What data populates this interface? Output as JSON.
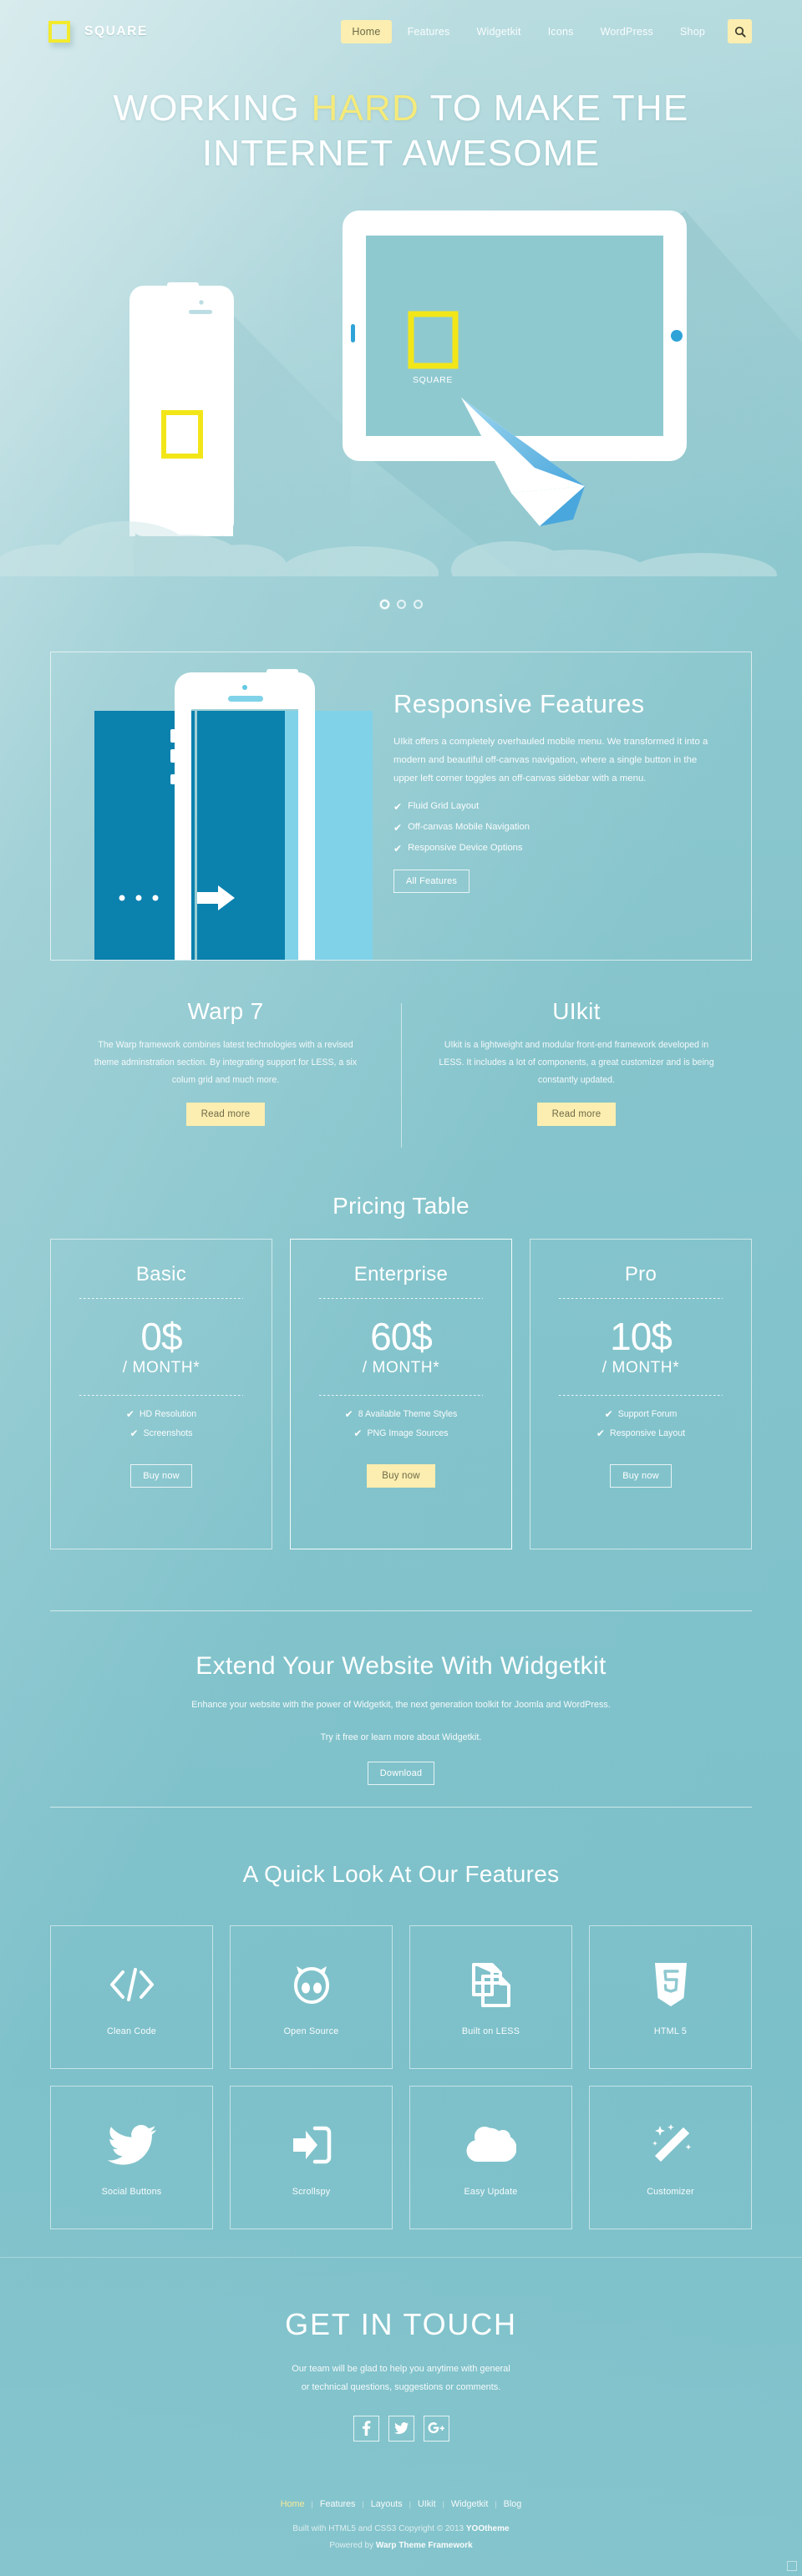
{
  "brand": {
    "name": "SQUARE",
    "mark_color": "#f2ea2e"
  },
  "nav": {
    "items": [
      {
        "label": "Home",
        "active": true
      },
      {
        "label": "Features",
        "active": false
      },
      {
        "label": "Widgetkit",
        "active": false
      },
      {
        "label": "Icons",
        "active": false
      },
      {
        "label": "WordPress",
        "active": false
      },
      {
        "label": "Shop",
        "active": false
      }
    ],
    "search_icon": "search-icon"
  },
  "hero": {
    "line1_a": "WORKING ",
    "line1_accent": "HARD",
    "line1_b": " TO MAKE THE",
    "line2": "INTERNET AWESOME",
    "accent_color": "#f4ea7a",
    "device_label": "SQUARE",
    "slider_dots": 3,
    "slider_active": 1
  },
  "responsive": {
    "title": "Responsive Features",
    "paragraph": "UIkit offers a completely overhauled mobile menu. We transformed it into a modern and beautiful off-canvas navigation, where a single button in the upper left corner toggles an off-canvas sidebar with a menu.",
    "features": [
      "Fluid Grid Layout",
      "Off-canvas Mobile Navigation",
      "Responsive Device Options"
    ],
    "button": "All Features"
  },
  "twocol": [
    {
      "title": "Warp 7",
      "text": "The Warp framework combines latest technologies with a revised theme adminstration section. By integrating support for LESS, a six colum grid and much more.",
      "button": "Read more"
    },
    {
      "title": "UIkit",
      "text": "UIkit is a lightweight and modular front-end framework developed in LESS. It includes a lot of components, a great customizer and is being constantly updated.",
      "button": "Read more"
    }
  ],
  "pricing": {
    "title": "Pricing Table",
    "plans": [
      {
        "name": "Basic",
        "price": "0$",
        "per": "/ MONTH*",
        "features": [
          "HD Resolution",
          "Screenshots"
        ],
        "button": "Buy now",
        "featured": false
      },
      {
        "name": "Enterprise",
        "price": "60$",
        "per": "/ MONTH*",
        "features": [
          "8 Available Theme Styles",
          "PNG Image Sources"
        ],
        "button": "Buy now",
        "featured": true
      },
      {
        "name": "Pro",
        "price": "10$",
        "per": "/ MONTH*",
        "features": [
          "Support Forum",
          "Responsive Layout"
        ],
        "button": "Buy now",
        "featured": false
      }
    ]
  },
  "widgetkit_cta": {
    "title": "Extend Your Website With Widgetkit",
    "line1": "Enhance your website with the power of Widgetkit, the next generation toolkit for Joomla and WordPress.",
    "line2": "Try it free or learn more about Widgetkit.",
    "button": "Download"
  },
  "features_grid": {
    "title": "A Quick Look At Our Features",
    "items": [
      {
        "label": "Clean Code",
        "icon": "code-brackets-icon"
      },
      {
        "label": "Open Source",
        "icon": "github-octocat-icon"
      },
      {
        "label": "Built on LESS",
        "icon": "stacked-files-icon"
      },
      {
        "label": "HTML 5",
        "icon": "html5-shield-icon"
      },
      {
        "label": "Social Buttons",
        "icon": "twitter-bird-icon"
      },
      {
        "label": "Scrollspy",
        "icon": "arrow-into-box-icon"
      },
      {
        "label": "Easy Update",
        "icon": "cloud-icon"
      },
      {
        "label": "Customizer",
        "icon": "magic-wand-icon"
      }
    ]
  },
  "get_in_touch": {
    "title": "GET IN TOUCH",
    "line1": "Our team will be glad to help you anytime with general",
    "line2": "or technical questions, suggestions or comments.",
    "socials": [
      {
        "name": "facebook-icon",
        "glyph": "f"
      },
      {
        "name": "twitter-icon",
        "glyph": "t"
      },
      {
        "name": "google-plus-icon",
        "glyph": "G+"
      }
    ]
  },
  "footer": {
    "links": [
      {
        "label": "Home",
        "active": true
      },
      {
        "label": "Features",
        "active": false
      },
      {
        "label": "Layouts",
        "active": false
      },
      {
        "label": "UIkit",
        "active": false
      },
      {
        "label": "Widgetkit",
        "active": false
      },
      {
        "label": "Blog",
        "active": false
      }
    ],
    "separator": "|",
    "copyright_prefix": "Built with HTML5 and CSS3 Copyright © 2013 ",
    "copyright_brand": "YOOtheme",
    "powered_prefix": "Powered by ",
    "powered_brand": "Warp Theme Framework"
  }
}
